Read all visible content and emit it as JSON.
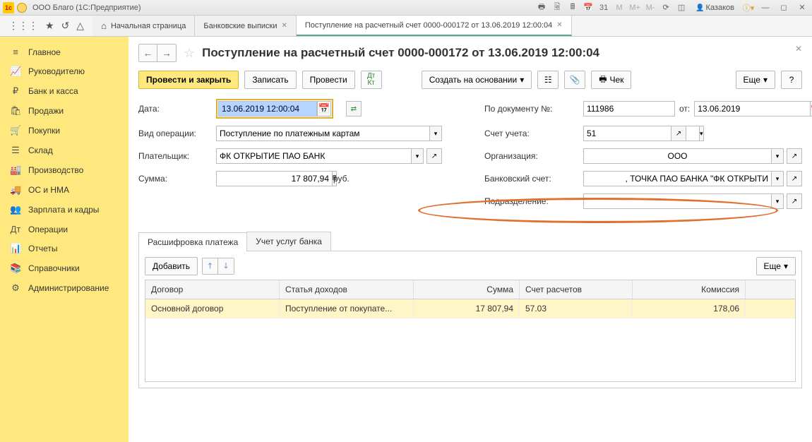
{
  "titlebar": {
    "app_title": "ООО Благо  (1С:Предприятие)",
    "user": "Казаков"
  },
  "toolbar": {
    "tabs": {
      "home": "Начальная страница",
      "bank": "Банковские выписки",
      "current": "Поступление на расчетный счет 0000-000172 от 13.06.2019 12:00:04"
    }
  },
  "sidebar": {
    "items": [
      {
        "icon": "≡",
        "label": "Главное"
      },
      {
        "icon": "📈",
        "label": "Руководителю"
      },
      {
        "icon": "₽",
        "label": "Банк и касса"
      },
      {
        "icon": "🛍",
        "label": "Продажи"
      },
      {
        "icon": "🛒",
        "label": "Покупки"
      },
      {
        "icon": "☰",
        "label": "Склад"
      },
      {
        "icon": "🏭",
        "label": "Производство"
      },
      {
        "icon": "🚚",
        "label": "ОС и НМА"
      },
      {
        "icon": "👥",
        "label": "Зарплата и кадры"
      },
      {
        "icon": "Дт",
        "label": "Операции"
      },
      {
        "icon": "📊",
        "label": "Отчеты"
      },
      {
        "icon": "📚",
        "label": "Справочники"
      },
      {
        "icon": "⚙",
        "label": "Администрирование"
      }
    ]
  },
  "page": {
    "title": "Поступление на расчетный счет 0000-000172 от 13.06.2019 12:00:04",
    "buttons": {
      "post_close": "Провести и закрыть",
      "save": "Записать",
      "post": "Провести",
      "create_based": "Создать на основании",
      "cheque": "Чек",
      "more": "Еще"
    },
    "labels": {
      "date": "Дата:",
      "op_type": "Вид операции:",
      "payer": "Плательщик:",
      "sum": "Сумма:",
      "doc_num": "По документу №:",
      "from": "от:",
      "account": "Счет учета:",
      "org": "Организация:",
      "bank_acct": "Банковский счет:",
      "division": "Подразделение:",
      "rub": "руб."
    },
    "values": {
      "date": "13.06.2019 12:00:04",
      "op_type": "Поступление по платежным картам",
      "payer": "ФК ОТКРЫТИЕ ПАО БАНК",
      "sum": "17 807,94",
      "doc_num": "111986",
      "doc_date": "13.06.2019",
      "account": "51",
      "org": "ООО",
      "bank_acct": ", ТОЧКА ПАО БАНКА \"ФК ОТКРЫТИ",
      "division": ""
    }
  },
  "subtabs": {
    "decode": "Расшифровка платежа",
    "services": "Учет услуг банка",
    "add": "Добавить",
    "more": "Еще"
  },
  "grid": {
    "headers": {
      "contract": "Договор",
      "income": "Статья доходов",
      "sum": "Сумма",
      "settle": "Счет расчетов",
      "commission": "Комиссия"
    },
    "row": {
      "contract": "Основной договор",
      "income": "Поступление от покупате...",
      "sum": "17 807,94",
      "settle": "57.03",
      "commission": "178,06"
    }
  }
}
